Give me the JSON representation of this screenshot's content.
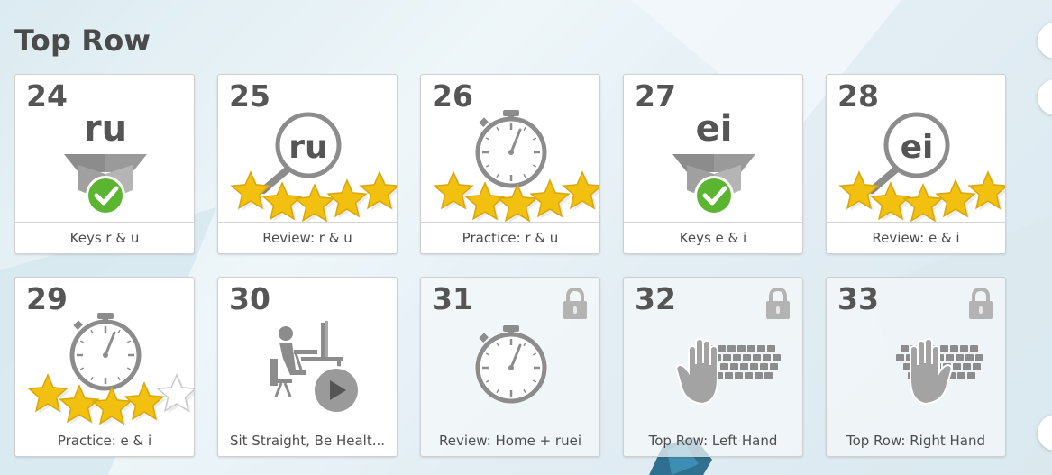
{
  "section": {
    "title": "Top Row"
  },
  "cards": [
    {
      "number": "24",
      "label": "Keys r & u",
      "art": "trophy-box",
      "letters": "ru",
      "stars": 0,
      "locked": false
    },
    {
      "number": "25",
      "label": "Review: r & u",
      "art": "magnifier",
      "letters": "ru",
      "stars": 5,
      "locked": false
    },
    {
      "number": "26",
      "label": "Practice: r & u",
      "art": "stopwatch",
      "letters": "",
      "stars": 5,
      "locked": false
    },
    {
      "number": "27",
      "label": "Keys e & i",
      "art": "trophy-box",
      "letters": "ei",
      "stars": 0,
      "locked": false
    },
    {
      "number": "28",
      "label": "Review: e & i",
      "art": "magnifier",
      "letters": "ei",
      "stars": 5,
      "locked": false
    },
    {
      "number": "29",
      "label": "Practice: e & i",
      "art": "stopwatch",
      "letters": "",
      "stars": 4,
      "locked": false
    },
    {
      "number": "30",
      "label": "Sit Straight, Be Healt...",
      "art": "video-posture",
      "letters": "",
      "stars": 0,
      "locked": false
    },
    {
      "number": "31",
      "label": "Review: Home + ruei",
      "art": "stopwatch",
      "letters": "",
      "stars": 0,
      "locked": true
    },
    {
      "number": "32",
      "label": "Top Row: Left Hand",
      "art": "keyboard-left-hand",
      "letters": "",
      "stars": 0,
      "locked": true
    },
    {
      "number": "33",
      "label": "Top Row: Right Hand",
      "art": "keyboard-right-hand",
      "letters": "",
      "stars": 0,
      "locked": true
    }
  ],
  "icons": {
    "lock": "lock-icon",
    "check": "check-icon",
    "star": "star-icon",
    "play": "play-icon"
  },
  "colors": {
    "title": "#4a4a4a",
    "icon_gray": "#8c8c8c",
    "check_green": "#5cb531",
    "star_gold": "#f2c10f"
  }
}
